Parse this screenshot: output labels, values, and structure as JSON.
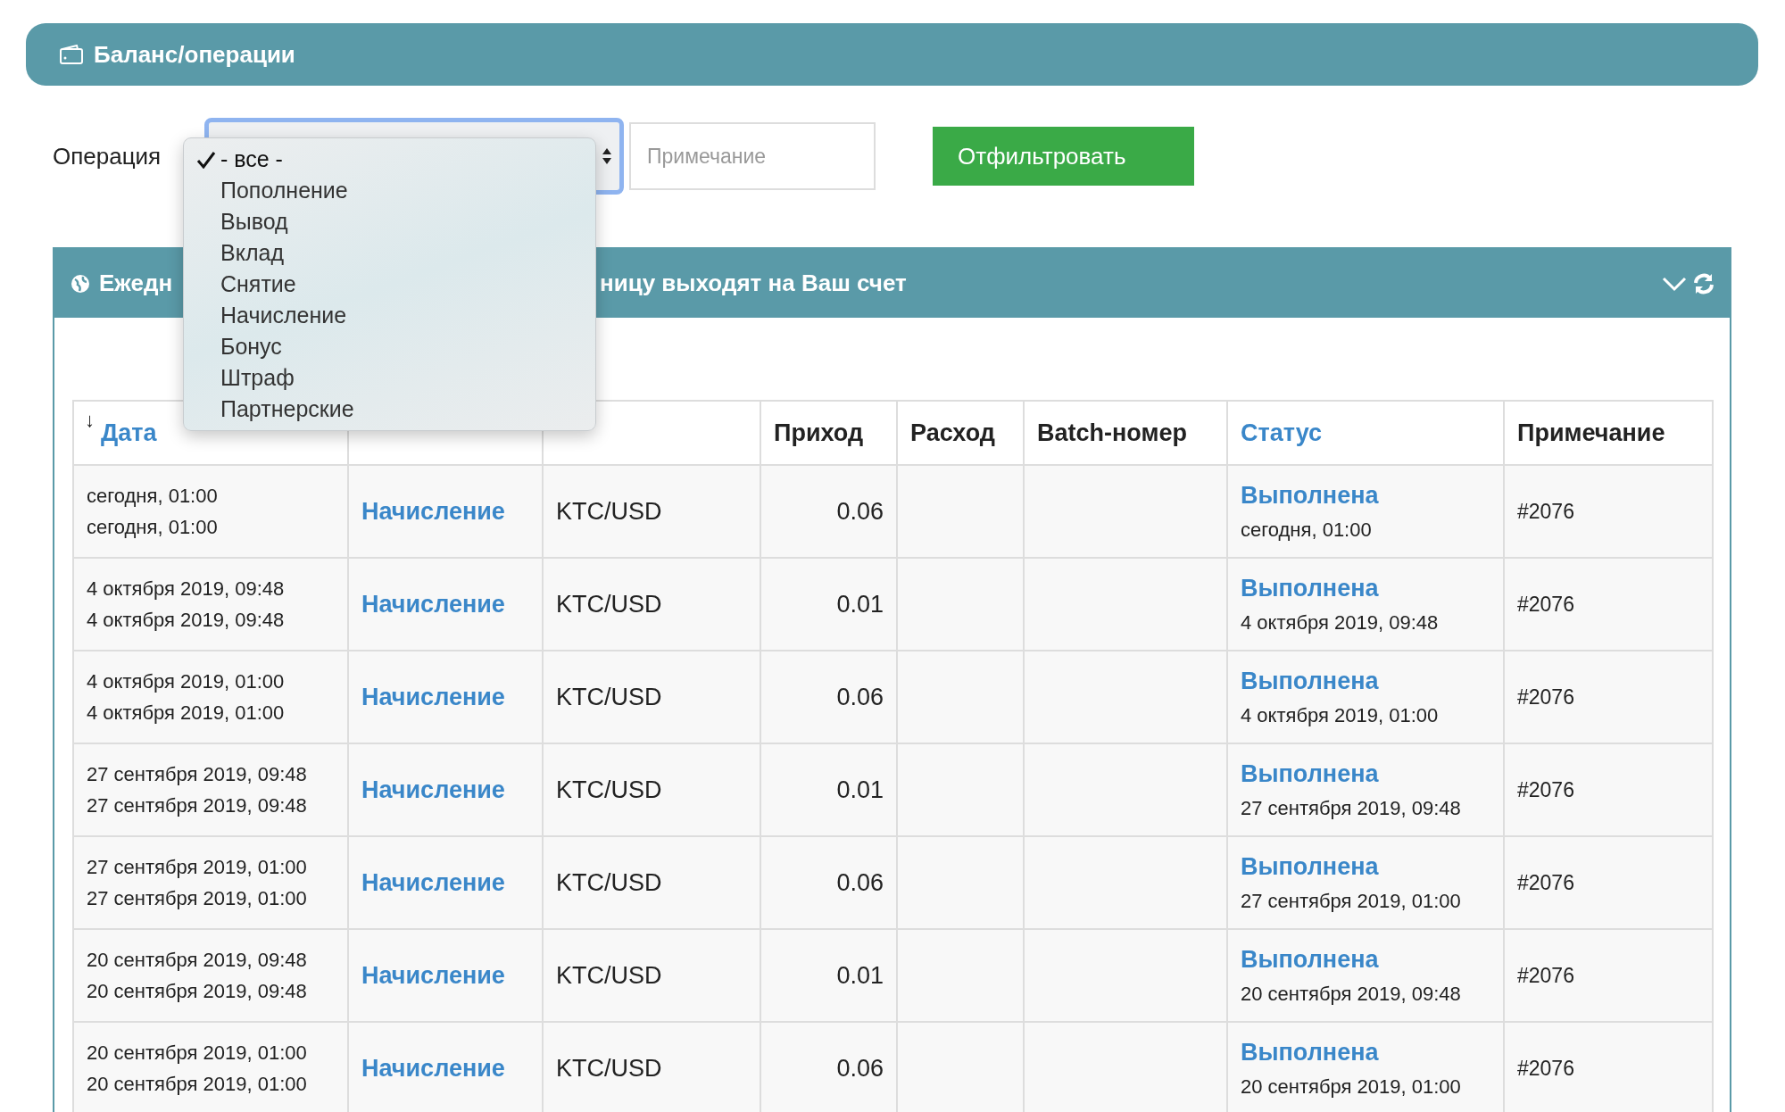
{
  "page_header": {
    "title": "Баланс/операции"
  },
  "filter": {
    "operation_label": "Операция",
    "operation_options": [
      {
        "label": "- все -",
        "selected": true
      },
      {
        "label": "Пополнение",
        "selected": false
      },
      {
        "label": "Вывод",
        "selected": false
      },
      {
        "label": "Вклад",
        "selected": false
      },
      {
        "label": "Снятие",
        "selected": false
      },
      {
        "label": "Начисление",
        "selected": false
      },
      {
        "label": "Бонус",
        "selected": false
      },
      {
        "label": "Штраф",
        "selected": false
      },
      {
        "label": "Партнерские",
        "selected": false
      }
    ],
    "note_placeholder": "Примечание",
    "button": "Отфильтровать"
  },
  "panel": {
    "title_start": "Ежедн",
    "title_end": "ницу выходят на Ваш счет",
    "table": {
      "sort_mark": "↓",
      "columns": [
        {
          "label": "Дата",
          "kind": "link"
        },
        {
          "kind": "covered"
        },
        {
          "kind": "covered"
        },
        {
          "label": "Приход",
          "kind": "plain"
        },
        {
          "label": "Расход",
          "kind": "plain"
        },
        {
          "label": "Batch-номер",
          "kind": "plain"
        },
        {
          "label": "Статус",
          "kind": "link"
        },
        {
          "label": "Примечание",
          "kind": "plain"
        }
      ],
      "rows": [
        {
          "date": "сегодня, 01:00",
          "date2": "сегодня, 01:00",
          "operation": "Начисление",
          "system": "KTC/USD",
          "income": "0.06",
          "status": "Выполнена",
          "status_date": "сегодня, 01:00",
          "note": "#2076"
        },
        {
          "date": "4 октября 2019, 09:48",
          "date2": "4 октября 2019, 09:48",
          "operation": "Начисление",
          "system": "KTC/USD",
          "income": "0.01",
          "status": "Выполнена",
          "status_date": "4 октября 2019, 09:48",
          "note": "#2076"
        },
        {
          "date": "4 октября 2019, 01:00",
          "date2": "4 октября 2019, 01:00",
          "operation": "Начисление",
          "system": "KTC/USD",
          "income": "0.06",
          "status": "Выполнена",
          "status_date": "4 октября 2019, 01:00",
          "note": "#2076"
        },
        {
          "date": "27 сентября 2019, 09:48",
          "date2": "27 сентября 2019, 09:48",
          "operation": "Начисление",
          "system": "KTC/USD",
          "income": "0.01",
          "status": "Выполнена",
          "status_date": "27 сентября 2019, 09:48",
          "note": "#2076"
        },
        {
          "date": "27 сентября 2019, 01:00",
          "date2": "27 сентября 2019, 01:00",
          "operation": "Начисление",
          "system": "KTC/USD",
          "income": "0.06",
          "status": "Выполнена",
          "status_date": "27 сентября 2019, 01:00",
          "note": "#2076"
        },
        {
          "date": "20 сентября 2019, 09:48",
          "date2": "20 сентября 2019, 09:48",
          "operation": "Начисление",
          "system": "KTC/USD",
          "income": "0.01",
          "status": "Выполнена",
          "status_date": "20 сентября 2019, 09:48",
          "note": "#2076"
        },
        {
          "date": "20 сентября 2019, 01:00",
          "date2": "20 сентября 2019, 01:00",
          "operation": "Начисление",
          "system": "KTC/USD",
          "income": "0.06",
          "status": "Выполнена",
          "status_date": "20 сентября 2019, 01:00",
          "note": "#2076"
        }
      ]
    }
  }
}
